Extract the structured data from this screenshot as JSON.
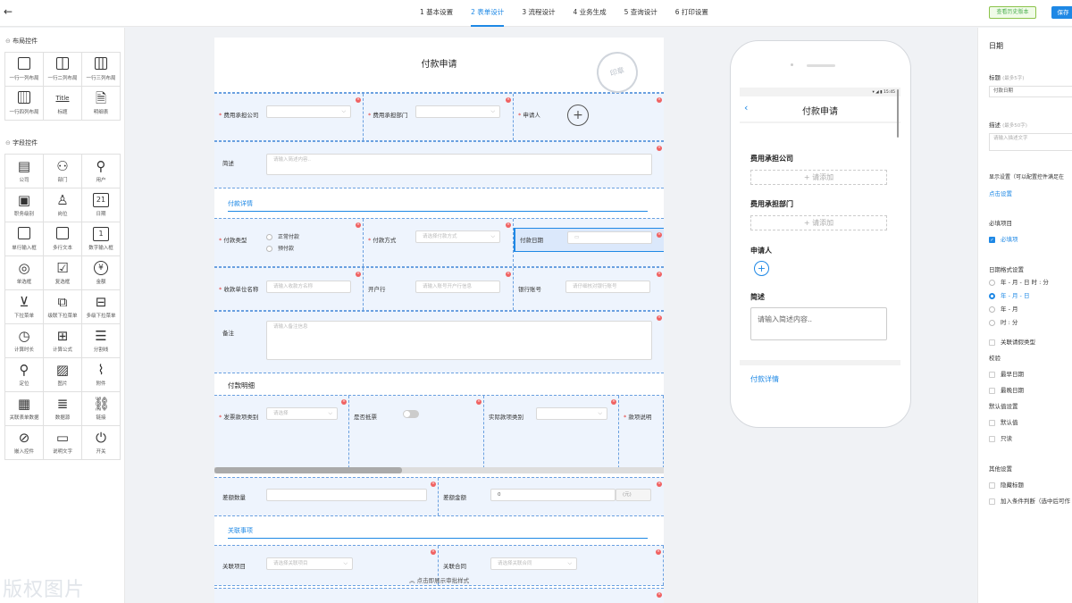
{
  "header": {
    "back_icon": "arrow-left-icon",
    "steps": [
      "1 基本设置",
      "2 表单设计",
      "3 流程设计",
      "4 业务生成",
      "5 查询设计",
      "6 打印设置"
    ],
    "active_step": 1,
    "history_btn": "查看历史版本",
    "save_btn": "保存"
  },
  "left": {
    "layout_title": "布局控件",
    "layout_items": [
      "一行一列布局",
      "一行二列布局",
      "一行三列布局",
      "一行四列布局",
      "标题",
      "明细表"
    ],
    "title_glyph": "Title",
    "field_title": "字段控件",
    "field_items": [
      "公司",
      "部门",
      "用户",
      "职务级别",
      "岗位",
      "日期",
      "单行输入框",
      "多行文本",
      "数字输入框",
      "单选框",
      "复选框",
      "金额",
      "下拉菜单",
      "级联下拉菜单",
      "多级下拉菜单",
      "计算时长",
      "计算公式",
      "分割线",
      "定位",
      "图片",
      "附件",
      "关联表单数据",
      "数据源",
      "链接",
      "嵌入控件",
      "说明文字",
      "开关"
    ],
    "date_glyph": "21",
    "number_glyph": "1",
    "money_glyph": "¥"
  },
  "form": {
    "title": "付款申请",
    "seal": "印章",
    "row1": {
      "company": "费用承担公司",
      "dept": "费用承担部门",
      "applicant": "申请人"
    },
    "row2": {
      "desc": "简述",
      "desc_ph": "请输入简述内容.."
    },
    "sec1": "付款详情",
    "row3": {
      "pay_type": "付款类型",
      "opt1": "正常付款",
      "opt2": "预付款",
      "pay_method": "付款方式",
      "pay_method_ph": "请选择付款方式",
      "pay_date": "付款日期"
    },
    "row4": {
      "payee": "收款单位名称",
      "payee_ph": "请输入收款方名称",
      "bank": "开户行",
      "bank_ph": "请输入账号开户行信息",
      "account": "银行账号",
      "account_ph": "请仔细核对银行账号"
    },
    "row5": {
      "remark": "备注",
      "remark_ph": "请输入备注信息"
    },
    "sec2": "付款明细",
    "row6": {
      "invoice": "发票款项类别",
      "invoice_ph": "请选择",
      "deduct": "是否抵票",
      "actual": "实际款项类别",
      "explain": "款项说明"
    },
    "row7": {
      "diff_qty": "差额数量",
      "diff_amt": "差额金额",
      "diff_amt_val": "0",
      "unit": "(元)"
    },
    "sec3": "关联事项",
    "row8": {
      "project": "关联项目",
      "project_ph": "请选择关联项目",
      "contract": "关联合同",
      "contract_ph": "请选择关联合同"
    },
    "bottom_hint": "点击即展示审批样式"
  },
  "phone": {
    "time": "15:45",
    "title": "付款申请",
    "company": "费用承担公司",
    "dept": "费用承担部门",
    "add": "+ 请添加",
    "applicant": "申请人",
    "desc": "简述",
    "desc_ph": "请输入简述内容..",
    "sec": "付款详情"
  },
  "right": {
    "title": "日期",
    "label_title": "标题",
    "label_hint": "(最多5字)",
    "title_val": "付款日期",
    "label_desc": "描述",
    "desc_hint": "(最多50字)",
    "desc_ph": "请输入描述文字",
    "display": "显示设置（可以配置控件满足在",
    "display_link": "点击设置",
    "required": "必填项目",
    "required_opt": "必填项",
    "format": "日期格式设置",
    "formats": [
      "年 - 月 - 日 时 : 分",
      "年 - 月 - 日",
      "年 - 月",
      "时 : 分"
    ],
    "relate_leave": "关联请假类型",
    "validate": "校验",
    "earliest": "最早日期",
    "latest": "最晚日期",
    "default": "默认值设置",
    "default_val": "默认值",
    "readonly": "只读",
    "other": "其他设置",
    "hide_title": "隐藏标题",
    "cond": "加入条件判断（选中后可作"
  },
  "watermark": "版权图片"
}
